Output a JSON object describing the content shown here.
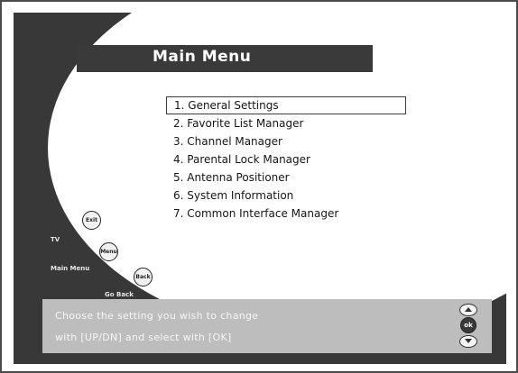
{
  "title": "Main Menu",
  "menu": {
    "items": [
      {
        "label": "1. General Settings",
        "selected": true
      },
      {
        "label": "2. Favorite List Manager"
      },
      {
        "label": "3. Channel Manager"
      },
      {
        "label": "4. Parental Lock Manager"
      },
      {
        "label": "5. Antenna Positioner"
      },
      {
        "label": "6. System Information"
      },
      {
        "label": "7. Common Interface Manager"
      }
    ]
  },
  "keys": {
    "exit": {
      "icon_text": "Exit",
      "label": "TV"
    },
    "menu": {
      "icon_text": "Menu",
      "label": "Main Menu"
    },
    "back": {
      "icon_text": "Back",
      "label": "Go Back"
    }
  },
  "help": {
    "line1": "Choose the setting you wish to change",
    "line2": "with [UP/DN] and select with [OK]",
    "ok_icon_text": "ok"
  },
  "colors": {
    "background": "#383838",
    "panel": "#ffffff",
    "title_bar": "#3a3a3a",
    "help_box": "#bdbdbd"
  }
}
